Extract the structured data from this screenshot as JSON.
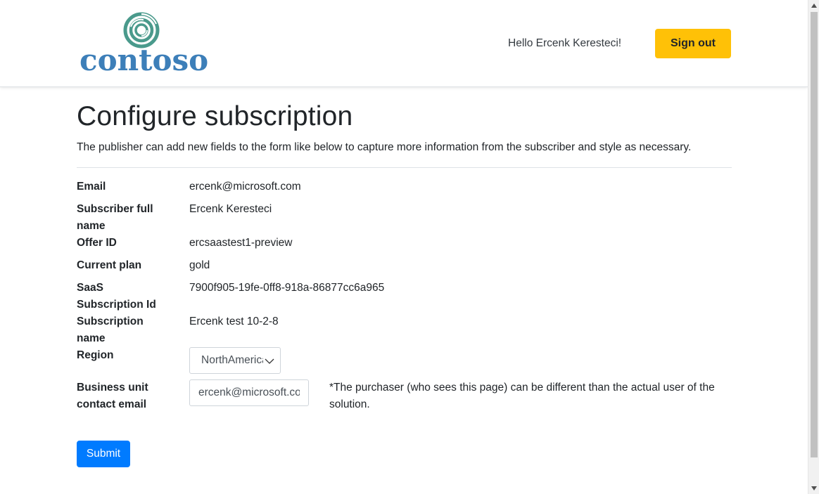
{
  "header": {
    "logo_text": "contoso",
    "logo_icon": "contoso-ring-logo",
    "greeting": "Hello Ercenk Keresteci!",
    "sign_out_label": "Sign out"
  },
  "main": {
    "title": "Configure subscription",
    "intro": "The publisher can add new fields to the form like below to capture more information from the subscriber and style as necessary.",
    "fields": {
      "email": {
        "label": "Email",
        "value": "ercenk@microsoft.com"
      },
      "full_name": {
        "label_line1": "Subscriber full",
        "label_line2": "name",
        "value": "Ercenk Keresteci"
      },
      "offer_id": {
        "label": "Offer ID",
        "value": "ercsaastest1-preview"
      },
      "current_plan": {
        "label": "Current plan",
        "value": "gold"
      },
      "saas_id": {
        "label_line1": "SaaS",
        "label_line2": "Subscription Id",
        "value": "7900f905-19fe-0ff8-918a-86877cc6a965"
      },
      "subscription_name": {
        "label_line1": "Subscription",
        "label_line2": "name",
        "value": "Ercenk test 10-2-8"
      },
      "region": {
        "label": "Region",
        "selected": "NorthAmerica"
      },
      "business_email": {
        "label_line1": "Business unit",
        "label_line2": "contact email",
        "value": "ercenk@microsoft.com",
        "note": "*The purchaser (who sees this page) can be different than the actual user of the solution."
      }
    },
    "submit_label": "Submit"
  },
  "colors": {
    "brand_blue": "#3d7fb9",
    "logo_teal": "#4a9a8c",
    "signout_yellow": "#ffc107",
    "submit_blue": "#007bff"
  }
}
